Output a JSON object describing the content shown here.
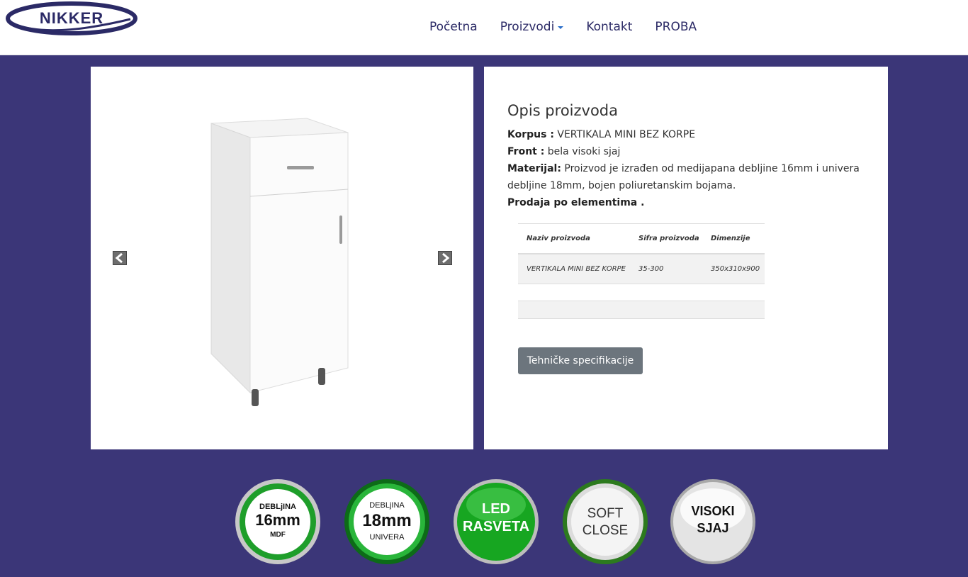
{
  "brand": {
    "logo_text": "NIKKER"
  },
  "nav": {
    "items": [
      {
        "label": "Početna"
      },
      {
        "label": "Proizvodi",
        "has_dropdown": true
      },
      {
        "label": "Kontakt"
      },
      {
        "label": "PROBA"
      }
    ]
  },
  "carousel": {
    "prev_icon": "chevron-left-icon",
    "next_icon": "chevron-right-icon"
  },
  "product": {
    "title": "Opis proizvoda",
    "korpus_label": "Korpus :",
    "korpus_value": "VERTIKALA MINI BEZ KORPE",
    "front_label": "Front :",
    "front_value": "bela visoki sjaj",
    "materijal_label": "Materijal:",
    "materijal_value": "Proizvod je izrađen od medijapana debljine 16mm i univera debljine 18mm, bojen poliuretanskim bojama.",
    "prodaja": "Prodaja po elementima ."
  },
  "spec_table": {
    "headers": [
      "Naziv proizvoda",
      "Sifra proizvoda",
      "Dimenzije"
    ],
    "rows": [
      [
        "VERTIKALA MINI BEZ KORPE",
        "35-300",
        "350x310x900"
      ]
    ]
  },
  "spec_button": "Tehničke specifikacije",
  "badges": [
    {
      "line1": "DEBLjINA",
      "line2": "16mm",
      "line3": "MDF"
    },
    {
      "line1": "DEBLjINA",
      "line2": "18mm",
      "line3": "UNIVERA"
    },
    {
      "line1": "LED",
      "line2": "RASVETA"
    },
    {
      "line1": "SOFT",
      "line2": "CLOSE"
    },
    {
      "line1": "VISOKI",
      "line2": "SJAJ"
    }
  ],
  "colors": {
    "background": "#3b3678",
    "nav_text": "#2b2a66",
    "button": "#6c757d",
    "badge_green": "#1e9e2a"
  }
}
